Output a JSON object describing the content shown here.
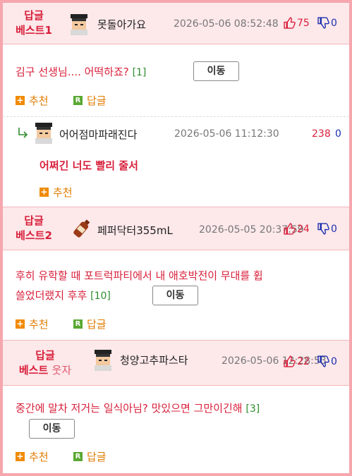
{
  "comments": [
    {
      "badge_line1": "답글",
      "badge_line2": "베스트1",
      "nickname": "못돌아가요",
      "date": "2026-05-06 08:52:48",
      "up": "75",
      "down": "0",
      "body": "김구 선생님.... 어떡하죠?",
      "reply_count": "[1]",
      "move_label": "이동",
      "recommend_label": "추천",
      "reply_label": "답글",
      "reply": {
        "nickname": "어어점마파래진다",
        "date": "2026-05-06 11:12:30",
        "up": "238",
        "down": "0",
        "body": "어쩌긴 너도 빨리 줄서",
        "recommend_label": "추천"
      }
    },
    {
      "badge_line1": "답글",
      "badge_line2": "베스트2",
      "nickname": "페퍼닥터355mL",
      "date": "2026-05-05 20:37:59",
      "up": "24",
      "down": "0",
      "body_line1": "후히 유학할 때 포트럭파티에서 내 애호박전이 무대를 휩",
      "body_line2": "쓸었더랬지 후후",
      "reply_count": "[10]",
      "move_label": "이동",
      "recommend_label": "추천",
      "reply_label": "답글"
    },
    {
      "badge_line1": "답글",
      "badge_line2_a": "베스트",
      "badge_line2_b": "웃자",
      "nickname": "청양고추파스타",
      "date": "2026-05-06 12:28:53",
      "up": "22",
      "down": "0",
      "body": "중간에 말차 저거는 일식아님? 맛있으면 그만이긴해",
      "reply_count": "[3]",
      "move_label": "이동",
      "recommend_label": "추천",
      "reply_label": "답글"
    }
  ],
  "colors": {
    "border": "#f5a7ad",
    "header_bg": "#fde8ea",
    "accent_red": "#d81f3a",
    "down_blue": "#1b2fb0",
    "count_green": "#2e8b2e",
    "action_orange": "#e07b00"
  },
  "icons": [
    "avatar-pixel-icon",
    "bottle-icon",
    "thumbs-up-icon",
    "thumbs-down-icon",
    "reply-arrow-icon",
    "plus-icon",
    "reply-r-icon"
  ]
}
